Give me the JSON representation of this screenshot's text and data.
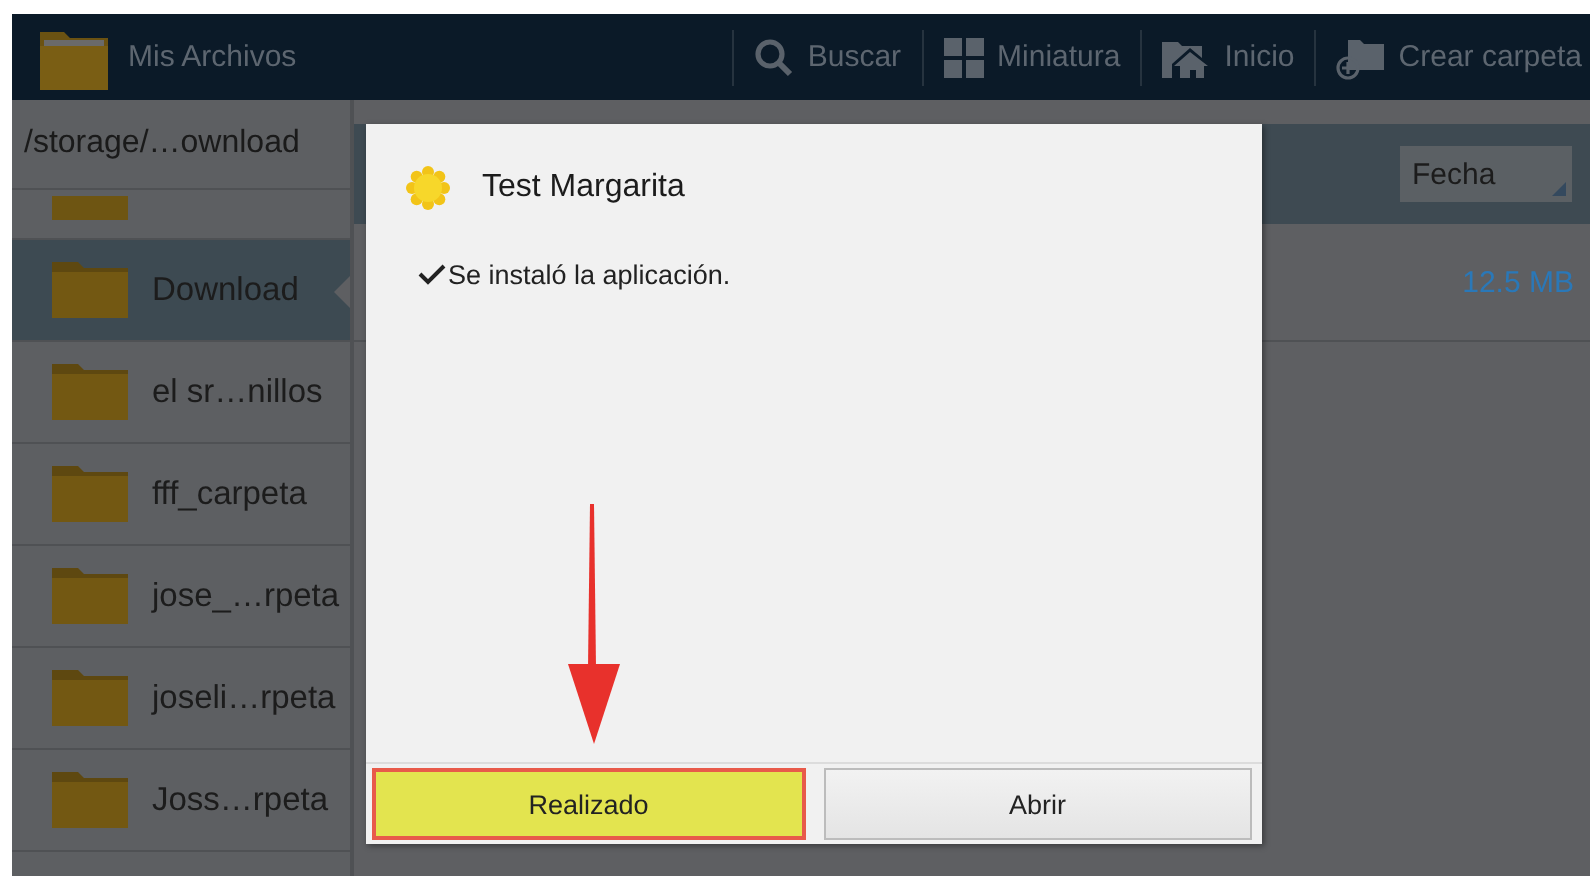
{
  "app_bar": {
    "title": "Mis Archivos",
    "actions": [
      {
        "label": "Buscar",
        "kind": "search"
      },
      {
        "label": "Miniatura",
        "kind": "grid"
      },
      {
        "label": "Inicio",
        "kind": "home"
      },
      {
        "label": "Crear carpeta",
        "kind": "new-folder"
      }
    ]
  },
  "sidebar": {
    "path": "/storage/…ownload",
    "folders": [
      {
        "name": "Download",
        "selected": true
      },
      {
        "name": "el sr…nillos",
        "selected": false
      },
      {
        "name": "fff_carpeta",
        "selected": false
      },
      {
        "name": "jose_…rpeta",
        "selected": false
      },
      {
        "name": "joseli…rpeta",
        "selected": false
      },
      {
        "name": "Joss…rpeta",
        "selected": false
      }
    ]
  },
  "file_list": {
    "sort": "Fecha",
    "rows": [
      {
        "size": "12.5 MB"
      }
    ]
  },
  "dialog": {
    "title": "Test Margarita",
    "message": "Se instaló la aplicación.",
    "buttons": [
      {
        "label": "Realizado",
        "highlighted": true
      },
      {
        "label": "Abrir",
        "highlighted": false
      }
    ]
  }
}
